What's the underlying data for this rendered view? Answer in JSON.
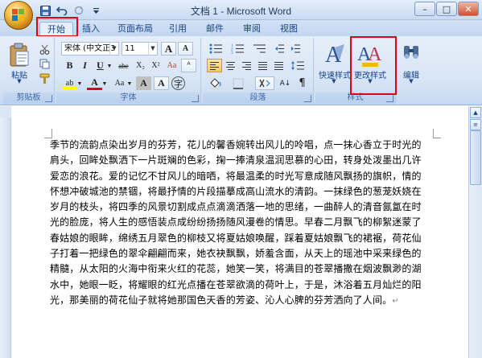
{
  "window": {
    "title": "文档 1 - Microsoft Word"
  },
  "quick_access": [
    "save-icon",
    "undo-icon",
    "redo-icon",
    "customize-icon"
  ],
  "tabs": [
    {
      "label": "开始",
      "active": true
    },
    {
      "label": "插入"
    },
    {
      "label": "页面布局"
    },
    {
      "label": "引用"
    },
    {
      "label": "邮件"
    },
    {
      "label": "审阅"
    },
    {
      "label": "视图"
    }
  ],
  "ribbon": {
    "clipboard": {
      "paste_label": "粘贴",
      "group_label": "剪贴板"
    },
    "font": {
      "font_name": "宋体 (中文正3",
      "font_size": "11",
      "grow_label": "A",
      "shrink_label": "A",
      "bold": "B",
      "italic": "I",
      "underline": "U",
      "strike": "abe",
      "sub": "X₂",
      "sup": "X²",
      "clear": "Aa",
      "highlight": "ab",
      "color": "A",
      "case": "Aa",
      "char_border": "A",
      "char_shading": "A",
      "enclose": "字",
      "phonetic": "wén",
      "group_label": "字体"
    },
    "paragraph": {
      "group_label": "段落",
      "sort_label": "A↓",
      "show_marks": "¶"
    },
    "styles": {
      "quick_label": "快速样式",
      "change_label": "更改样式",
      "group_label": "样式"
    },
    "editing": {
      "label": "编辑"
    }
  },
  "document": {
    "paragraph_lines": [
      "季节的流韵点染出岁月的芬芳，花儿的馨香婉转出风儿的呤唱，点一抹心香立于时光的",
      "肩头，回眸处飘洒下一片斑斓的色彩，掬一捧清泉温润思慕的心田，转身处泼墨出几许",
      "爱恋的浪花。爱的记忆不甘风儿的暗哂，将最温柔的时光写意成随风飘扬的旗帜，情的",
      "怀想冲破城池的禁锢，将最抒情的片段描摹成高山流水的清韵。一抹绿色的葱茏妖娆在",
      "岁月的枝头，将四季的风景切割成点点滴滴洒落一地的思绪，一曲醉人的清音氤氲在时",
      "光的脸庞，将人生的感悟装点成纷纷扬扬随风漫卷的情思。早春二月飘飞的柳絮迷蒙了",
      "春姑娘的眼眸，绵绣五月翠色的柳枝又将夏姑娘唤醒，踩着夏姑娘飘飞的裙裾，荷花仙",
      "子打着一把绿色的翠伞翩翩而来，她衣袂飘飘，娇羞含面，从天上的瑶池中采来绿色的",
      "精髓，从太阳的火海中衔来火红的花蕊，她笑一笑，将满目的苍翠播撒在烟波飘渺的湖",
      "水中，她眼一眨，将耀眼的红光点播在苍翠欲滴的荷叶上，于是，沐浴着五月灿烂的阳",
      "光，那美丽的荷花仙子就将她那国色天香的芳姿、沁人心脾的芬芳洒向了人间。"
    ],
    "paragraph_mark": "↵"
  }
}
